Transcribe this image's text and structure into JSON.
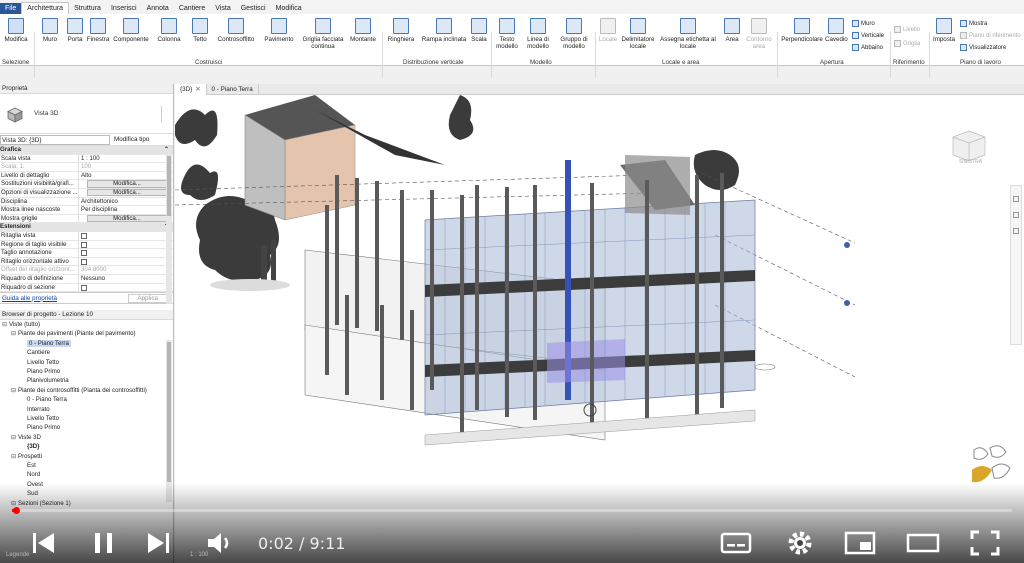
{
  "ribbon_tabs": [
    "File",
    "Architettura",
    "Struttura",
    "Inserisci",
    "Annota",
    "Cantiere",
    "Vista",
    "Gestisci",
    "Modifica"
  ],
  "active_tab": "Architettura",
  "ribbon": {
    "modifica": "Modifica",
    "selezione": "Selezione",
    "build_items": [
      "Muro",
      "Porta",
      "Finestra",
      "Componente",
      "Colonna",
      "Tetto",
      "Controsoffitto",
      "Pavimento",
      "Griglia facciata continua",
      "Montante"
    ],
    "costruisci": "Costruisci",
    "circ_items": [
      "Ringhiera",
      "Rampa inclinata",
      "Scala"
    ],
    "distribuzione": "Distribuzione verticale",
    "model_items": [
      "Testo modello",
      "Linea di modello",
      "Gruppo di modello"
    ],
    "modello": "Modello",
    "room_items": [
      "Locale",
      "Delimitatore locale",
      "Assegna etichetta al locale",
      "Area",
      "Contorno area"
    ],
    "locale_area": "Locale e area",
    "opening_items": [
      "Perpendicolare",
      "Cavedio"
    ],
    "opening_small": [
      "Muro",
      "Verticale",
      "Abbaino"
    ],
    "apertura": "Apertura",
    "ref_small": [
      "Livello",
      "Griglia"
    ],
    "riferimento": "Riferimento",
    "imposta": "Imposta",
    "work_small": [
      "Mostra",
      "Piano di riferimento",
      "Visualizzatore"
    ],
    "piano_lavoro": "Piano di lavoro"
  },
  "properties": {
    "title": "Proprietà",
    "type_name": "Vista 3D",
    "selector": "Vista 3D: {3D}",
    "edit_type": "Modifica tipo",
    "rows": [
      {
        "k": "Grafica",
        "cat": true
      },
      {
        "k": "Scala vista",
        "v": "1 : 100"
      },
      {
        "k": "Scala: 1:",
        "v": "100",
        "dim": true
      },
      {
        "k": "Livello di dettaglio",
        "v": "Alto"
      },
      {
        "k": "Sostituzioni visibilità/grafi...",
        "v": "Modifica...",
        "btn": true
      },
      {
        "k": "Opzioni di visualizzazione ...",
        "v": "Modifica...",
        "btn": true
      },
      {
        "k": "Disciplina",
        "v": "Architettonico"
      },
      {
        "k": "Mostra linee nascoste",
        "v": "Per disciplina"
      },
      {
        "k": "Mostra griglie",
        "v": "Modifica...",
        "btn": true
      },
      {
        "k": "Estensioni",
        "cat": true
      },
      {
        "k": "Ritaglia vista",
        "chk": true
      },
      {
        "k": "Regione di taglio visibile",
        "chk": true
      },
      {
        "k": "Taglio annotazione",
        "chk": true
      },
      {
        "k": "Ritaglio orizzontale attivo",
        "chk": true
      },
      {
        "k": "Offset del ritaglio orizzont...",
        "v": "304.8000",
        "dim": true
      },
      {
        "k": "Riquadro di definizione",
        "v": "Nessuno"
      },
      {
        "k": "Riquadro di sezione",
        "chk": true
      }
    ],
    "help_link": "Guida alle proprietà",
    "apply": "Applica"
  },
  "browser": {
    "title": "Browser di progetto - Lezione 10",
    "nodes": [
      {
        "t": "Viste (tutto)",
        "lvl": 0,
        "exp": "-"
      },
      {
        "t": "Piante dei pavimenti (Piante del pavimento)",
        "lvl": 1,
        "exp": "-"
      },
      {
        "t": "0 - Piano Terra",
        "lvl": 2,
        "sel": true
      },
      {
        "t": "Cantiere",
        "lvl": 2
      },
      {
        "t": "Livello Tetto",
        "lvl": 2
      },
      {
        "t": "Piano Primo",
        "lvl": 2
      },
      {
        "t": "Planivolumetria",
        "lvl": 2
      },
      {
        "t": "Piante dei controsoffitti (Pianta dei controsoffitti)",
        "lvl": 1,
        "exp": "-"
      },
      {
        "t": "0 - Piano Terra",
        "lvl": 2
      },
      {
        "t": "Interrato",
        "lvl": 2
      },
      {
        "t": "Livello Tetto",
        "lvl": 2
      },
      {
        "t": "Piano Primo",
        "lvl": 2
      },
      {
        "t": "Viste 3D",
        "lvl": 1,
        "exp": "-"
      },
      {
        "t": "{3D}",
        "lvl": 2,
        "bold": true
      },
      {
        "t": "Prospetti",
        "lvl": 1,
        "exp": "-"
      },
      {
        "t": "Est",
        "lvl": 2
      },
      {
        "t": "Nord",
        "lvl": 2
      },
      {
        "t": "Ovest",
        "lvl": 2
      },
      {
        "t": "Sud",
        "lvl": 2
      },
      {
        "t": "Sezioni (Sezione 1)",
        "lvl": 1,
        "exp": "-"
      }
    ],
    "legend": "Legende"
  },
  "view_tabs": [
    "{3D}",
    "0 - Piano Terra"
  ],
  "viewcube_label": "SINISTRA",
  "scale_status": "1 : 100",
  "video": {
    "current": "0:02",
    "duration": "9:11",
    "time_text": "0:02 / 9:11",
    "progress": 0.0036
  },
  "colors": {
    "accent": "#2b5797",
    "progress_red": "#ff0000",
    "glass": "#7f9ac4"
  }
}
